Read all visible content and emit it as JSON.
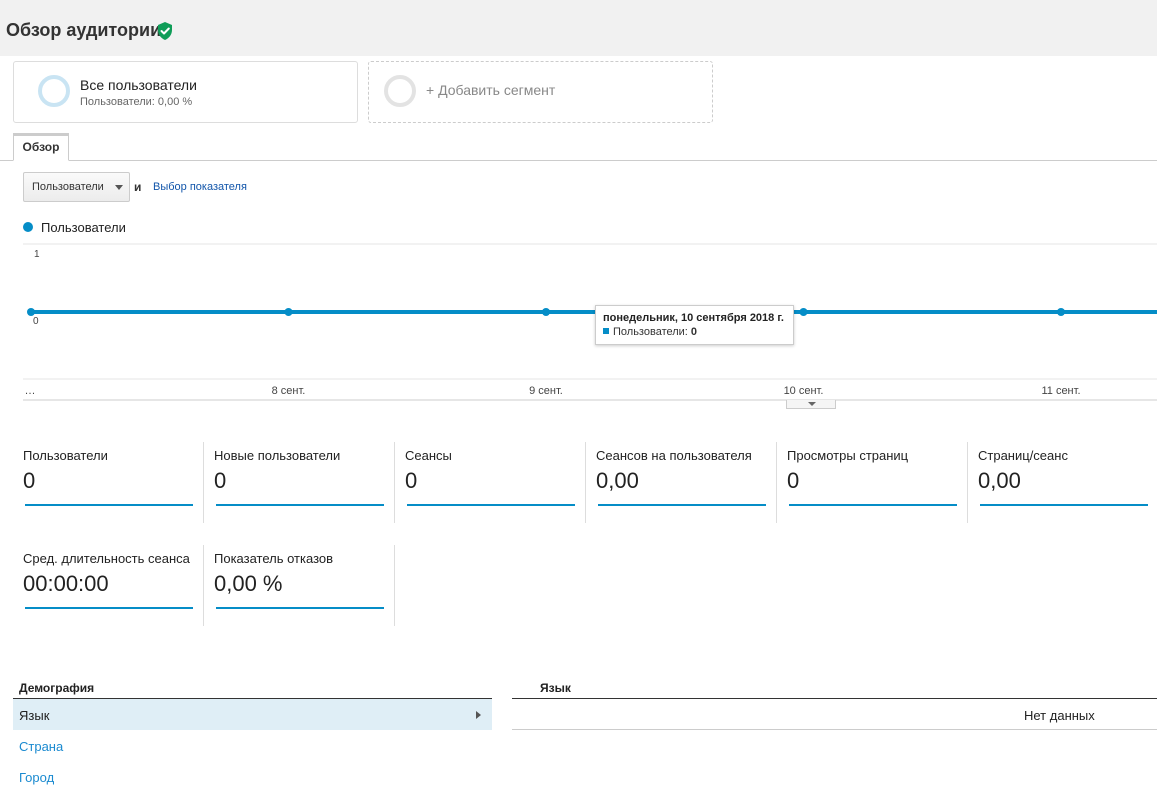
{
  "page": {
    "title": "Обзор аудитории",
    "title_icon": "verified-shield-icon",
    "accent_color": "#058dc7"
  },
  "segments": [
    {
      "title": "Все пользователи",
      "subtitle": "Пользователи: 0,00 %"
    },
    {
      "title": "+ Добавить сегмент"
    }
  ],
  "tabs": [
    {
      "label": "Обзор"
    }
  ],
  "controls": {
    "metric_select": "Пользователи",
    "and": "и",
    "choose_metric": "Выбор показателя"
  },
  "chart_data": {
    "type": "line",
    "x": [
      "…",
      "8 сент.",
      "9 сент.",
      "10 сент.",
      "11 сент."
    ],
    "series": [
      {
        "name": "Пользователи",
        "values": [
          0,
          0,
          0,
          0,
          0
        ]
      }
    ],
    "y_ticks": [
      "1",
      "0"
    ],
    "ylim": [
      0,
      1
    ],
    "grid": true
  },
  "tooltip": {
    "title": "понедельник, 10 сентября 2018 г.",
    "series_label": "Пользователи:",
    "value": "0"
  },
  "stats": [
    {
      "label": "Пользователи",
      "value": "0"
    },
    {
      "label": "Новые пользователи",
      "value": "0"
    },
    {
      "label": "Сеансы",
      "value": "0"
    },
    {
      "label": "Сеансов на пользователя",
      "value": "0,00"
    },
    {
      "label": "Просмотры страниц",
      "value": "0"
    },
    {
      "label": "Страниц/сеанс",
      "value": "0,00"
    },
    {
      "label": "Сред. длительность сеанса",
      "value": "00:00:00"
    },
    {
      "label": "Показатель отказов",
      "value": "0,00 %"
    }
  ],
  "demographics": {
    "title": "Демография",
    "items": [
      {
        "label": "Язык"
      },
      {
        "label": "Страна"
      },
      {
        "label": "Город"
      }
    ],
    "right_title": "Язык",
    "no_data": "Нет данных"
  }
}
